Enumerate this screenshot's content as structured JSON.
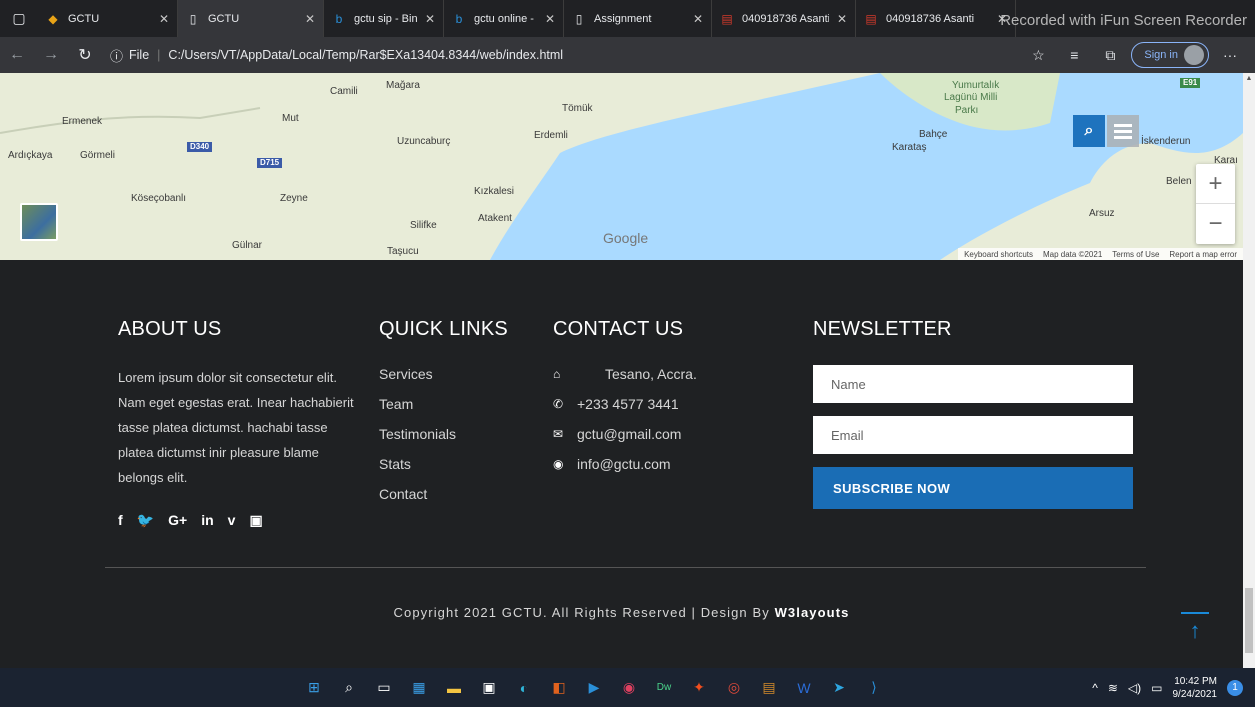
{
  "browser": {
    "tabs": [
      {
        "label": "GCTU",
        "icon": "gctu-logo-icon",
        "color": "#e8a317"
      },
      {
        "label": "GCTU",
        "icon": "page-icon",
        "color": "#e8eaed"
      },
      {
        "label": "gctu sip - Bing",
        "icon": "bing-icon",
        "color": "#2a8fd8"
      },
      {
        "label": "gctu online - Bing",
        "icon": "bing-icon",
        "color": "#2a8fd8"
      },
      {
        "label": "Assignment",
        "icon": "page-icon",
        "color": "#e8eaed"
      },
      {
        "label": "040918736 Asanti",
        "icon": "pdf-icon",
        "color": "#d33a2c"
      },
      {
        "label": "040918736 Asanti",
        "icon": "pdf-icon",
        "color": "#d33a2c"
      }
    ],
    "recorder_watermark": "Recorded with iFun Screen Recorder",
    "address": {
      "scheme_label": "File",
      "url": "C:/Users/VT/AppData/Local/Temp/Rar$EXa13404.8344/web/index.html"
    },
    "signin_label": "Sign in"
  },
  "map": {
    "labels": [
      {
        "text": "Camili",
        "cls": ""
      },
      {
        "text": "Mağara",
        "cls": ""
      },
      {
        "text": "Ermenek",
        "cls": ""
      },
      {
        "text": "Mut",
        "cls": ""
      },
      {
        "text": "Tömük",
        "cls": ""
      },
      {
        "text": "Erdemli",
        "cls": ""
      },
      {
        "text": "Uzuncaburç",
        "cls": ""
      },
      {
        "text": "Ardıçkaya",
        "cls": ""
      },
      {
        "text": "Görmeli",
        "cls": ""
      },
      {
        "text": "Kızkalesi",
        "cls": ""
      },
      {
        "text": "Köseçobanlı",
        "cls": ""
      },
      {
        "text": "Zeyne",
        "cls": ""
      },
      {
        "text": "Atakent",
        "cls": ""
      },
      {
        "text": "Silifke",
        "cls": ""
      },
      {
        "text": "Gülnar",
        "cls": ""
      },
      {
        "text": "Taşucu",
        "cls": ""
      },
      {
        "text": "Yumurtalık",
        "cls": "green"
      },
      {
        "text": "Lagünü Milli",
        "cls": "green"
      },
      {
        "text": "Parkı",
        "cls": "green"
      },
      {
        "text": "Bahçe",
        "cls": ""
      },
      {
        "text": "Karataş",
        "cls": ""
      },
      {
        "text": "İskenderun",
        "cls": ""
      },
      {
        "text": "Karaı",
        "cls": ""
      },
      {
        "text": "Belen",
        "cls": ""
      },
      {
        "text": "Arsuz",
        "cls": ""
      }
    ],
    "roads": [
      "D340",
      "D715",
      "E91"
    ],
    "google_logo": "Google",
    "attribution": [
      "Keyboard shortcuts",
      "Map data ©2021",
      "Terms of Use",
      "Report a map error"
    ],
    "zoom_in": "+",
    "zoom_out": "−"
  },
  "footer": {
    "about": {
      "heading": "ABOUT US",
      "text": "Lorem ipsum dolor sit consectetur elit. Nam eget egestas erat. Inear hachabierit tasse platea dictumst. hachabi tasse platea dictumst inir pleasure blame belongs elit.",
      "social": [
        {
          "glyph": "f",
          "name": "facebook-icon"
        },
        {
          "glyph": "🐦",
          "name": "twitter-icon"
        },
        {
          "glyph": "G+",
          "name": "google-plus-icon"
        },
        {
          "glyph": "in",
          "name": "linkedin-icon"
        },
        {
          "glyph": "v",
          "name": "vimeo-icon"
        },
        {
          "glyph": "▣",
          "name": "youtube-icon"
        }
      ]
    },
    "quick_links": {
      "heading": "QUICK LINKS",
      "items": [
        "Services",
        "Team",
        "Testimonials",
        "Stats",
        "Contact"
      ]
    },
    "contact": {
      "heading": "CONTACT US",
      "items": [
        {
          "icon": "home-icon",
          "glyph": "⌂",
          "text": "Tesano, Accra."
        },
        {
          "icon": "phone-icon",
          "glyph": "✆",
          "text": "+233 4577 3441"
        },
        {
          "icon": "envelope-icon",
          "glyph": "✉",
          "text": "gctu@gmail.com"
        },
        {
          "icon": "globe-icon",
          "glyph": "◉",
          "text": "info@gctu.com"
        }
      ]
    },
    "newsletter": {
      "heading": "NEWSLETTER",
      "name_placeholder": "Name",
      "email_placeholder": "Email",
      "subscribe_label": "SUBSCRIBE NOW"
    },
    "copyright": "Copyright 2021 GCTU. All Rights Reserved | Design By ",
    "designer": "W3layouts"
  },
  "taskbar": {
    "clock_time": "10:42 PM",
    "clock_date": "9/24/2021",
    "notification_count": "1",
    "apps": [
      {
        "name": "windows-start-icon",
        "glyph": "⊞",
        "color": "#3a9ee6"
      },
      {
        "name": "search-icon",
        "glyph": "⌕",
        "color": "#ffffff"
      },
      {
        "name": "task-view-icon",
        "glyph": "▭",
        "color": "#ffffff"
      },
      {
        "name": "widgets-icon",
        "glyph": "▦",
        "color": "#3a9ee6"
      },
      {
        "name": "file-explorer-icon",
        "glyph": "▬",
        "color": "#f4c542"
      },
      {
        "name": "store-icon",
        "glyph": "▣",
        "color": "#ffffff"
      },
      {
        "name": "edge-icon",
        "glyph": "◐",
        "color": "#2fb5d9"
      },
      {
        "name": "office-icon",
        "glyph": "◧",
        "color": "#e0621e"
      },
      {
        "name": "media-player-icon",
        "glyph": "▶",
        "color": "#2a8fd8"
      },
      {
        "name": "recorder-icon",
        "glyph": "◉",
        "color": "#e04060"
      },
      {
        "name": "dreamweaver-icon",
        "glyph": "Dw",
        "color": "#4ad28a"
      },
      {
        "name": "figma-icon",
        "glyph": "✦",
        "color": "#f24e1e"
      },
      {
        "name": "chrome-icon",
        "glyph": "◎",
        "color": "#e04a3a"
      },
      {
        "name": "winrar-icon",
        "glyph": "▤",
        "color": "#d18a2a"
      },
      {
        "name": "word-icon",
        "glyph": "W",
        "color": "#2b6cd6"
      },
      {
        "name": "telegram-icon",
        "glyph": "➤",
        "color": "#2ea6e0"
      },
      {
        "name": "vscode-icon",
        "glyph": "⟩",
        "color": "#2a8fd8"
      }
    ]
  }
}
